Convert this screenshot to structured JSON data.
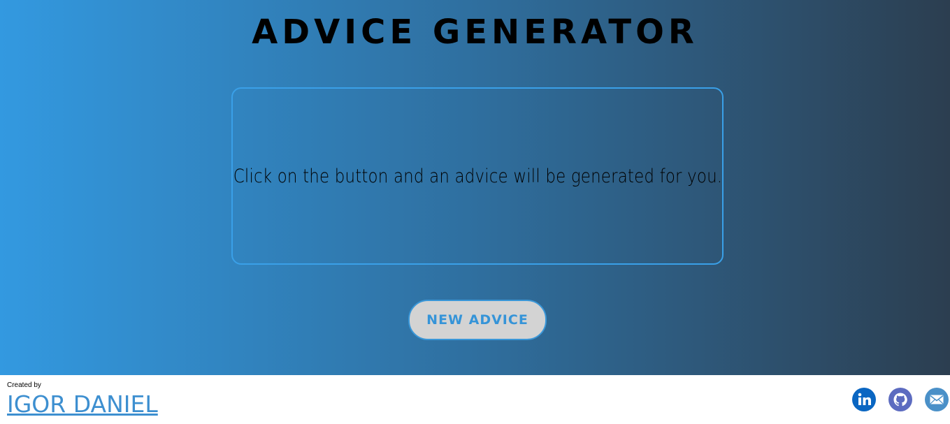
{
  "header": {
    "title": "ADVICE GENERATOR"
  },
  "advice": {
    "text": "Click on the button and an advice will be generated for you."
  },
  "button": {
    "label": "NEW ADVICE"
  },
  "footer": {
    "created_by": "Created by",
    "author": "IGOR DANIEL",
    "social": [
      {
        "name": "linkedin-icon",
        "color": "#0a66c2"
      },
      {
        "name": "github-icon",
        "color": "#5c6bc0"
      },
      {
        "name": "email-icon",
        "color": "#4a90c8"
      }
    ]
  },
  "colors": {
    "gradient_start": "#3399e0",
    "gradient_end": "#2c3e50",
    "card_border": "#3aa0e8",
    "button_bg": "#d3d3d3",
    "button_text": "#3594d8",
    "author_link": "#3d8fd0"
  }
}
